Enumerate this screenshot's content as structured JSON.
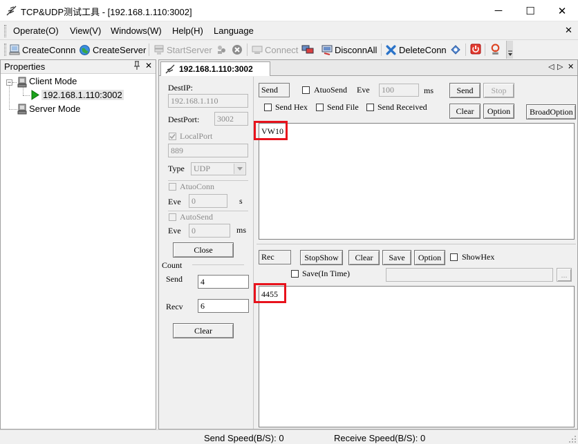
{
  "window": {
    "title": "TCP&UDP测试工具 - [192.168.1.110:3002]",
    "min": "─",
    "max": "☐",
    "close": "✕"
  },
  "menu": {
    "operate": "Operate(O)",
    "view": "View(V)",
    "windows": "Windows(W)",
    "help": "Help(H)",
    "language": "Language",
    "close": "✕"
  },
  "toolbar": {
    "create_conn": "CreateConnn",
    "create_server": "CreateServer",
    "start_server": "StartServer",
    "connect": "Connect",
    "disconn_all": "DisconnAll",
    "delete_conn": "DeleteConn"
  },
  "properties": {
    "title": "Properties",
    "pin": "ᵖ",
    "close": "✕",
    "tree": {
      "client_mode": "Client Mode",
      "client_conn": "192.168.1.110:3002",
      "server_mode": "Server Mode"
    }
  },
  "tab": {
    "label": "192.168.1.110:3002",
    "prev": "◁",
    "next": "▷",
    "close": "✕"
  },
  "left_panel": {
    "dest_ip_label": "DestIP:",
    "dest_ip": "192.168.1.110",
    "dest_port_label": "DestPort:",
    "dest_port": "3002",
    "local_port_label": "LocalPort",
    "local_port": "889",
    "type_label": "Type",
    "type_value": "UDP",
    "atuo_conn_label": "AtuoConn",
    "eve_label_1": "Eve",
    "eve_value_1": "0",
    "unit_s": "s",
    "auto_send_label": "AutoSend",
    "eve_label_2": "Eve",
    "eve_value_2": "0",
    "unit_ms": "ms",
    "close_button": "Close",
    "count_label": "Count",
    "send_label": "Send",
    "send_count": "4",
    "recv_label": "Recv",
    "recv_count": "6",
    "clear_button": "Clear"
  },
  "send_panel": {
    "send_tag": "Send",
    "atuo_send_label": "AtuoSend",
    "eve_label": "Eve",
    "eve_value": "100",
    "unit_ms": "ms",
    "send_button": "Send",
    "stop_button": "Stop",
    "send_hex_label": "Send Hex",
    "send_file_label": "Send File",
    "send_received_label": "Send Received",
    "clear_button": "Clear",
    "option_button": "Option",
    "broad_option_button": "BroadOption",
    "content": "VW10"
  },
  "recv_panel": {
    "rec_tag": "Rec",
    "stop_show_button": "StopShow",
    "clear_button": "Clear",
    "save_button": "Save",
    "option_button": "Option",
    "show_hex_label": "ShowHex",
    "save_in_time_label": "Save(In Time)",
    "browse_button": "...",
    "content": "4455"
  },
  "status": {
    "send_speed": "Send Speed(B/S): 0",
    "receive_speed": "Receive Speed(B/S): 0"
  },
  "colors": {
    "highlight": "#e8121c",
    "play_green": "#1aa31a"
  }
}
